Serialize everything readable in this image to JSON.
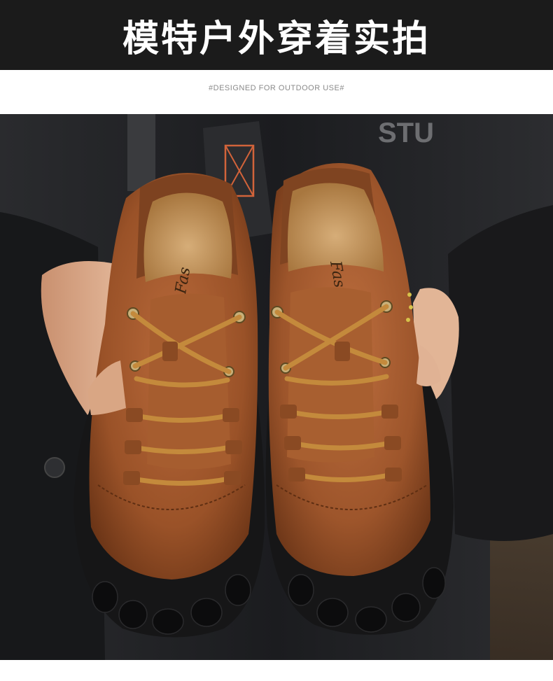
{
  "header": {
    "title": "模特户外穿着实拍",
    "background": "#1b1b1b"
  },
  "subtitle": "#DESIGNED FOR OUTDOOR USE#",
  "photo": {
    "insole_brand": "Fas",
    "jacket_text": "STU",
    "colors": {
      "leather": "#a0592a",
      "leather_dark": "#6e3716",
      "laces": "#c48a3c",
      "sole": "#1a1a1a",
      "jacket": "#222326"
    }
  }
}
